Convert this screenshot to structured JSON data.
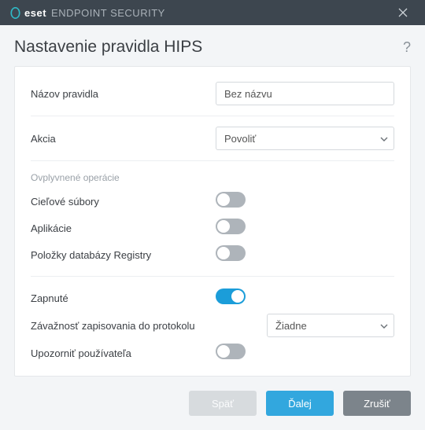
{
  "titlebar": {
    "brand": "eset",
    "product": "ENDPOINT SECURITY"
  },
  "page": {
    "title": "Nastavenie pravidla HIPS"
  },
  "fields": {
    "rule_name": {
      "label": "Názov pravidla",
      "value": "Bez názvu"
    },
    "action": {
      "label": "Akcia",
      "selected": "Povoliť"
    },
    "section_ops": "Ovplyvnené operácie",
    "target_files": {
      "label": "Cieľové súbory",
      "on": false
    },
    "applications": {
      "label": "Aplikácie",
      "on": false
    },
    "registry": {
      "label": "Položky databázy Registry",
      "on": false
    },
    "enabled": {
      "label": "Zapnuté",
      "on": true
    },
    "log_severity": {
      "label": "Závažnosť zapisovania do protokolu",
      "selected": "Žiadne"
    },
    "notify_user": {
      "label": "Upozorniť používateľa",
      "on": false
    }
  },
  "buttons": {
    "back": "Späť",
    "next": "Ďalej",
    "cancel": "Zrušiť"
  }
}
